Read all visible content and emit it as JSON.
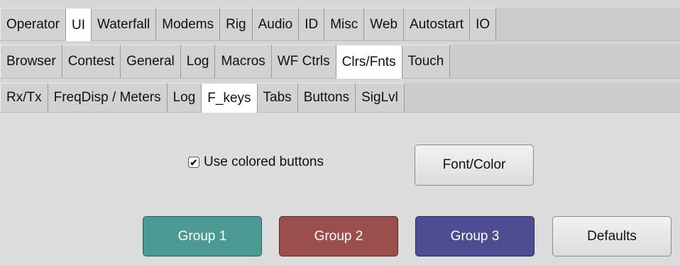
{
  "tabs_row1": {
    "items": [
      "Operator",
      "UI",
      "Waterfall",
      "Modems",
      "Rig",
      "Audio",
      "ID",
      "Misc",
      "Web",
      "Autostart",
      "IO"
    ],
    "active": "UI"
  },
  "tabs_row2": {
    "items": [
      "Browser",
      "Contest",
      "General",
      "Log",
      "Macros",
      "WF Ctrls",
      "Clrs/Fnts",
      "Touch"
    ],
    "active": "Clrs/Fnts"
  },
  "tabs_row3": {
    "items": [
      "Rx/Tx",
      "FreqDisp / Meters",
      "Log",
      "F_keys",
      "Tabs",
      "Buttons",
      "SigLvl"
    ],
    "active": "F_keys"
  },
  "panel": {
    "checkbox_label": "Use colored buttons",
    "checkbox_checked": true,
    "font_color_button": "Font/Color",
    "group1_button": "Group 1",
    "group2_button": "Group 2",
    "group3_button": "Group 3",
    "defaults_button": "Defaults"
  },
  "colors": {
    "group1": "#4c9a94",
    "group2": "#9b4f4c",
    "group3": "#4e4c93"
  }
}
